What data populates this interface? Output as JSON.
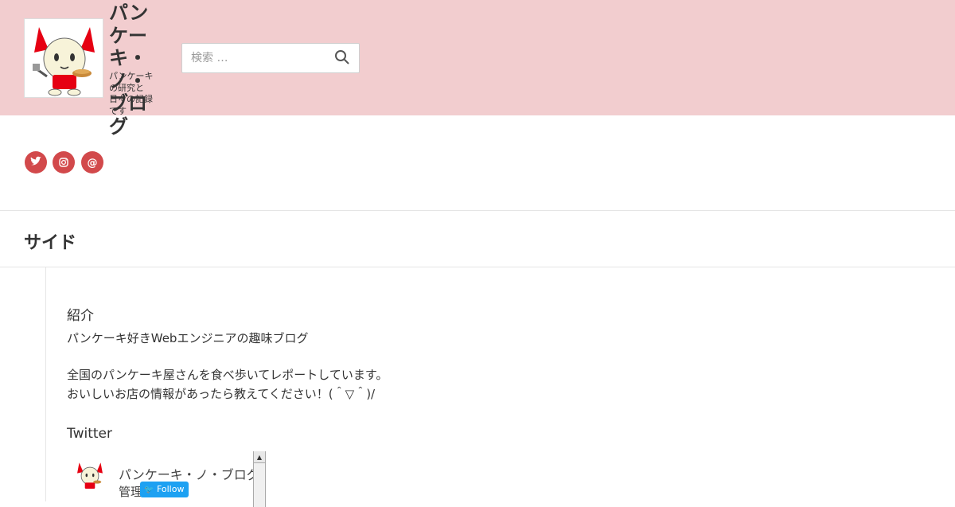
{
  "header": {
    "site_title": "パンケーキ・ノ・ブログ",
    "site_description": "パンケーキの研究と日々の記録です",
    "logo_icon": "mascot-logo-icon"
  },
  "search": {
    "placeholder": "検索 …",
    "icon": "search-icon"
  },
  "social": {
    "items": [
      {
        "label": "twitter",
        "glyph": "🐦",
        "icon": "twitter-icon"
      },
      {
        "label": "instagram",
        "glyph": "◎",
        "icon": "instagram-icon"
      },
      {
        "label": "email",
        "glyph": "@",
        "icon": "email-icon"
      }
    ],
    "accent": "#d2494b"
  },
  "page": {
    "title": "サイド"
  },
  "widgets": {
    "profile": {
      "title": "紹介",
      "line1": "パンケーキ好きWebエンジニアの趣味ブログ",
      "line2": "全国のパンケーキ屋さんを食べ歩いてレポートしています。",
      "line3": "おいしいお店の情報があったら教えてください！(＾▽＾)/"
    },
    "twitter": {
      "title": "Twitter",
      "name": "パンケーキ・ノ・ブログ",
      "handle": "管理",
      "follow_label": "Follow",
      "follow_color": "#1da1f2"
    }
  },
  "colors": {
    "header_bg": "#f2cdcf",
    "accent": "#d2494b"
  }
}
